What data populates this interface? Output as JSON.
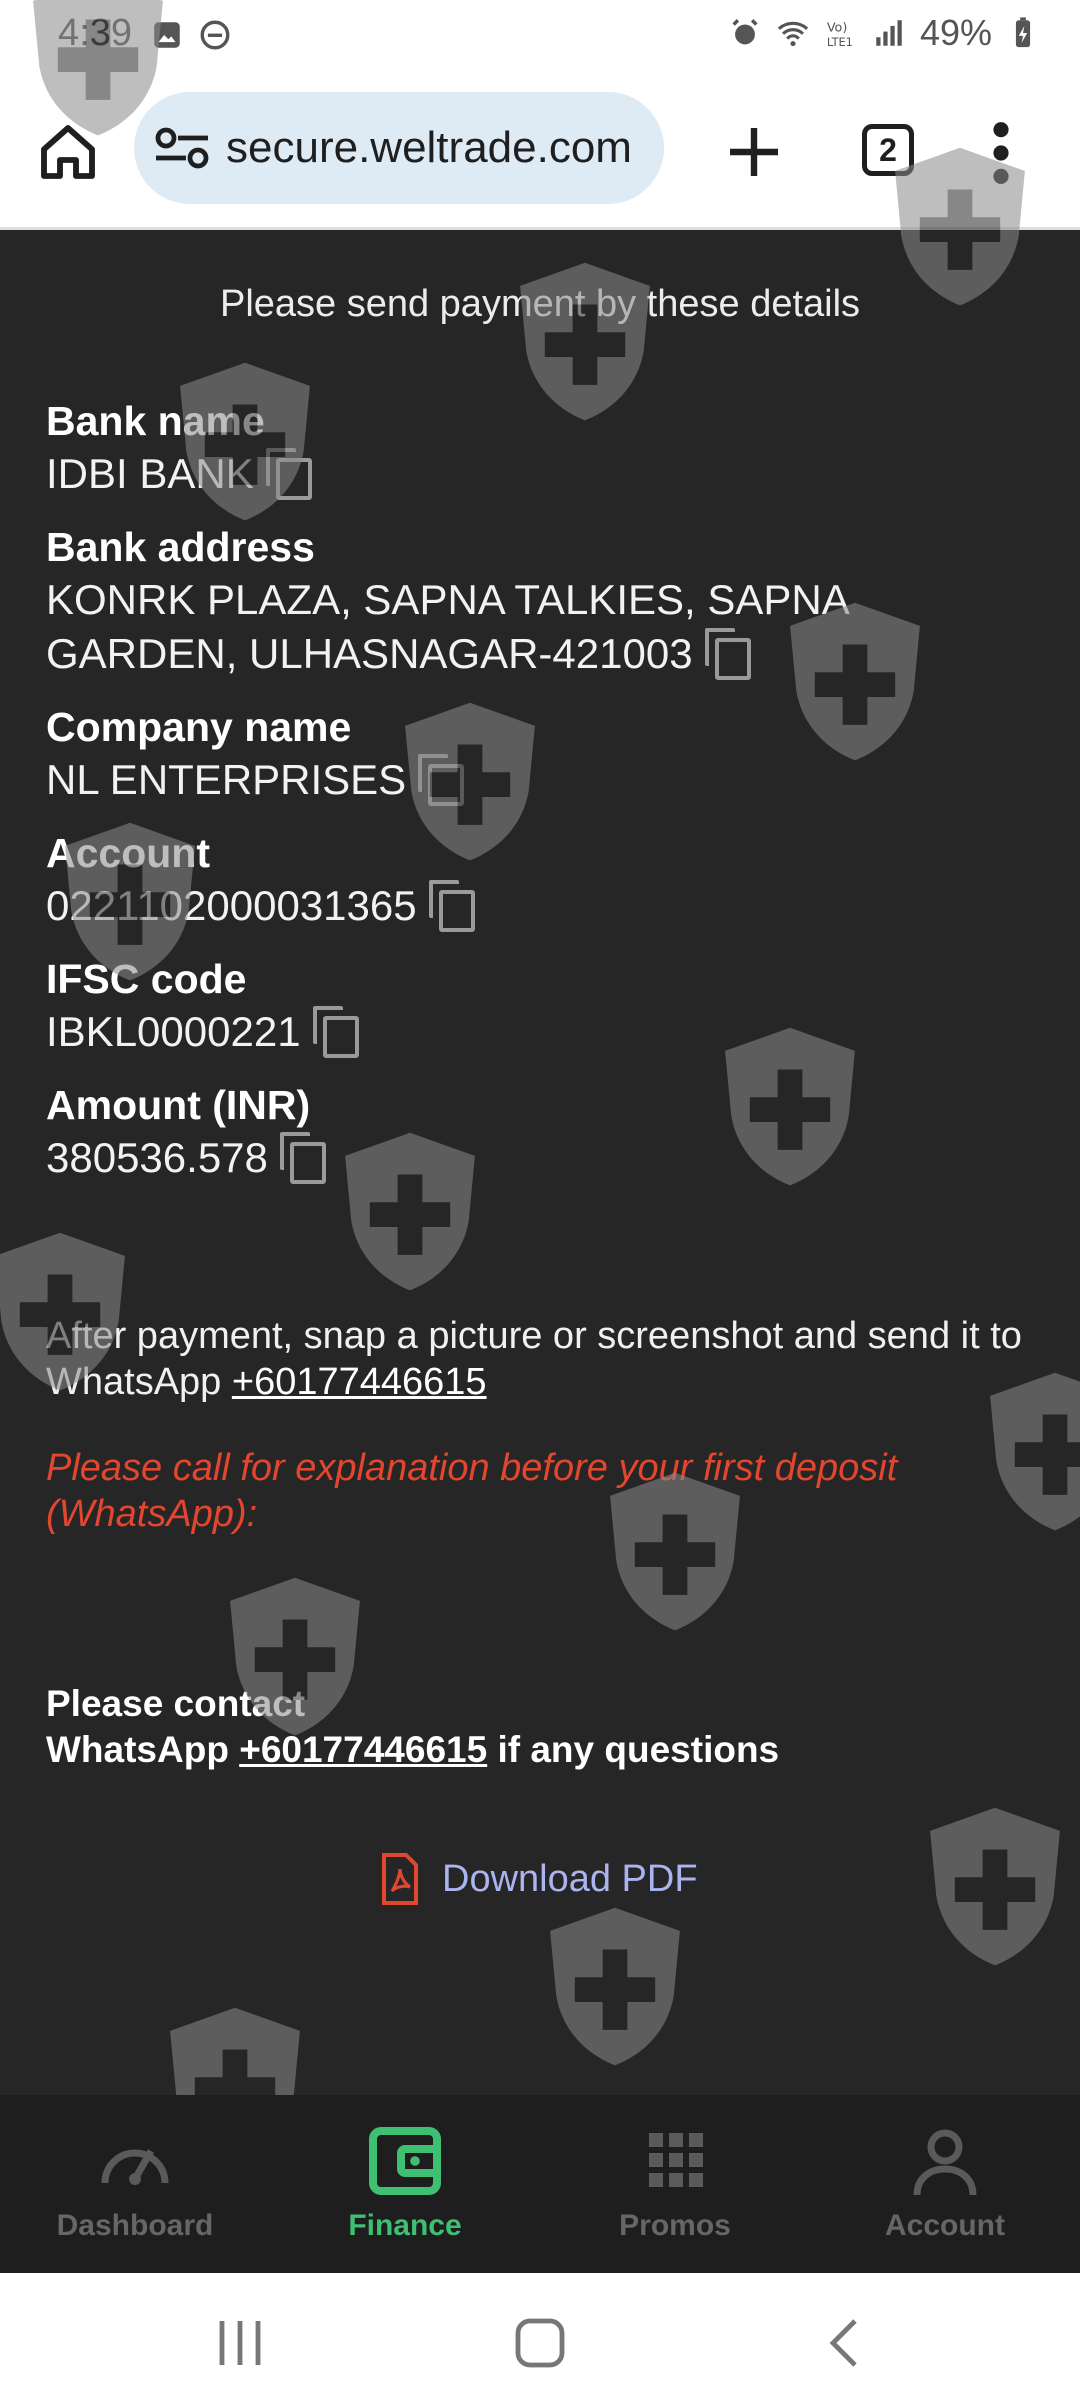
{
  "status_bar": {
    "time": "4:39",
    "battery": "49%"
  },
  "browser": {
    "url": "secure.weltrade.com",
    "tab_count": "2"
  },
  "content": {
    "headline": "Please send payment by these details",
    "details": [
      {
        "label": "Bank name",
        "value": "IDBI BANK"
      },
      {
        "label": "Bank address",
        "value": "KONRK PLAZA, SAPNA TALKIES, SAPNA GARDEN, ULHASNAGAR-421003"
      },
      {
        "label": "Company name",
        "value": "NL ENTERPRISES"
      },
      {
        "label": "Account",
        "value": "0221102000031365"
      },
      {
        "label": "IFSC code",
        "value": "IBKL0000221"
      },
      {
        "label": "Amount (INR)",
        "value": "380536.578"
      }
    ],
    "after_payment_text": "After payment, snap a picture or screenshot and send it to WhatsApp",
    "whatsapp_number": "+60177446615",
    "warning_text": "Please call for explanation before your first deposit (WhatsApp):",
    "contact_line1": "Please contact",
    "contact_prefix": "WhatsApp",
    "contact_suffix": "if any questions",
    "download_label": "Download PDF"
  },
  "bottom_nav": {
    "items": [
      {
        "label": "Dashboard",
        "icon": "speedometer-icon",
        "active": false
      },
      {
        "label": "Finance",
        "icon": "wallet-icon",
        "active": true
      },
      {
        "label": "Promos",
        "icon": "grid-icon",
        "active": false
      },
      {
        "label": "Account",
        "icon": "person-icon",
        "active": false
      }
    ]
  },
  "colors": {
    "background": "#262626",
    "accent_active": "#3fbf72",
    "warning": "#e2462f",
    "link": "#a9b4f0"
  }
}
